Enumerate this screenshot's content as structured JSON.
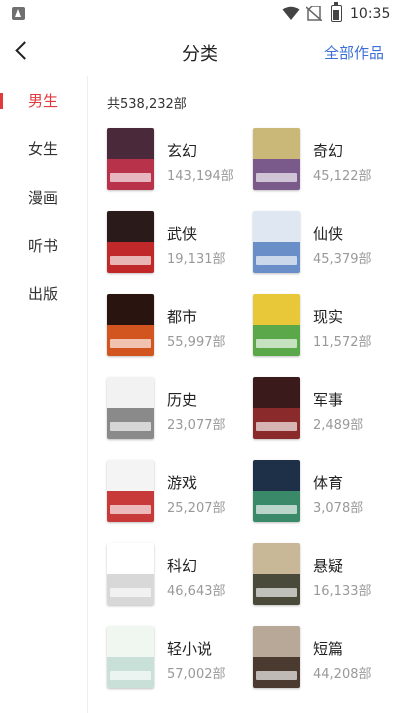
{
  "status_bar": {
    "time": "10:35"
  },
  "header": {
    "title": "分类",
    "right_link": "全部作品"
  },
  "sidebar": {
    "items": [
      {
        "label": "男生",
        "active": true
      },
      {
        "label": "女生",
        "active": false
      },
      {
        "label": "漫画",
        "active": false
      },
      {
        "label": "听书",
        "active": false
      },
      {
        "label": "出版",
        "active": false
      }
    ]
  },
  "main": {
    "total": "共538,232部",
    "categories": [
      {
        "name": "玄幻",
        "count": "143,194部",
        "cover_colors": [
          "#4a2a3a",
          "#b8324a"
        ]
      },
      {
        "name": "奇幻",
        "count": "45,122部",
        "cover_colors": [
          "#c9b878",
          "#7a5a8a"
        ]
      },
      {
        "name": "武侠",
        "count": "19,131部",
        "cover_colors": [
          "#2a1a1a",
          "#c0282a"
        ]
      },
      {
        "name": "仙侠",
        "count": "45,379部",
        "cover_colors": [
          "#dfe8f2",
          "#6a8fc8"
        ]
      },
      {
        "name": "都市",
        "count": "55,997部",
        "cover_colors": [
          "#2a1410",
          "#d2541e"
        ]
      },
      {
        "name": "现实",
        "count": "11,572部",
        "cover_colors": [
          "#e8c838",
          "#5aa84a"
        ]
      },
      {
        "name": "历史",
        "count": "23,077部",
        "cover_colors": [
          "#f2f2f2",
          "#8a8a8a"
        ]
      },
      {
        "name": "军事",
        "count": "2,489部",
        "cover_colors": [
          "#3a1a1a",
          "#8a2a2a"
        ]
      },
      {
        "name": "游戏",
        "count": "25,207部",
        "cover_colors": [
          "#f4f4f4",
          "#c83a3a"
        ]
      },
      {
        "name": "体育",
        "count": "3,078部",
        "cover_colors": [
          "#1e3048",
          "#3a8a6a"
        ]
      },
      {
        "name": "科幻",
        "count": "46,643部",
        "cover_colors": [
          "#ffffff",
          "#d8d8d8"
        ]
      },
      {
        "name": "悬疑",
        "count": "16,133部",
        "cover_colors": [
          "#c8b898",
          "#4a4a3a"
        ]
      },
      {
        "name": "轻小说",
        "count": "57,002部",
        "cover_colors": [
          "#f0f6f0",
          "#c8e0d8"
        ]
      },
      {
        "name": "短篇",
        "count": "44,208部",
        "cover_colors": [
          "#b8a898",
          "#4a3a30"
        ]
      }
    ]
  }
}
